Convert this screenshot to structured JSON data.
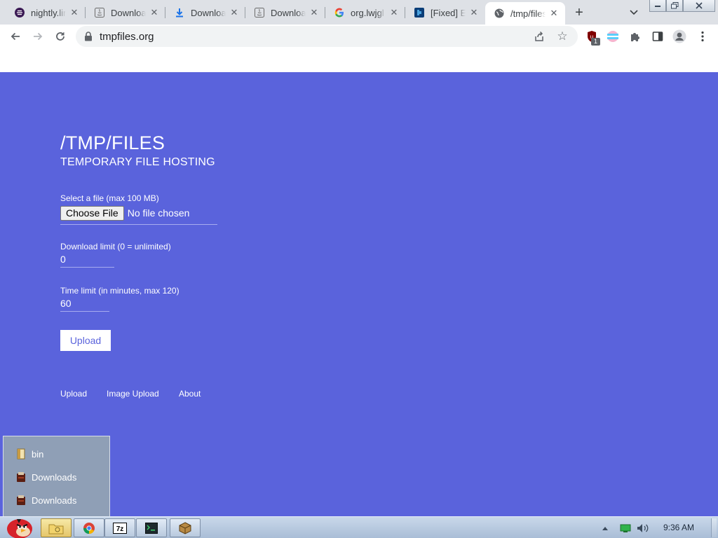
{
  "browser": {
    "tabs": [
      {
        "title": "nightly.lin",
        "icon": "eclipse-icon"
      },
      {
        "title": "Download",
        "icon": "java-icon"
      },
      {
        "title": "Download",
        "icon": "download-icon"
      },
      {
        "title": "Download",
        "icon": "java-icon"
      },
      {
        "title": "org.lwjgl",
        "icon": "google-icon"
      },
      {
        "title": "[Fixed] E",
        "icon": "site-icon"
      },
      {
        "title": "/tmp/files",
        "icon": "globe-icon",
        "active": true
      }
    ],
    "url": "tmpfiles.org",
    "extension_badge": "1"
  },
  "page": {
    "title": "/TMP/FILES",
    "subtitle": "TEMPORARY FILE HOSTING",
    "file_label": "Select a file (max 100 MB)",
    "choose_file_label": "Choose File",
    "no_file_text": "No file chosen",
    "download_limit_label": "Download limit (0 = unlimited)",
    "download_limit_value": "0",
    "time_limit_label": "Time limit (in minutes, max 120)",
    "time_limit_value": "60",
    "upload_button": "Upload",
    "footer_links": [
      "Upload",
      "Image Upload",
      "About"
    ],
    "colors": {
      "background": "#5a63dc",
      "text": "#ffffff"
    }
  },
  "folder_menu": {
    "items": [
      {
        "label": "bin"
      },
      {
        "label": "Downloads"
      },
      {
        "label": "Downloads"
      }
    ]
  },
  "taskbar": {
    "clock": "9:36 AM",
    "apps": [
      "angry-birds-start-icon",
      "folder-icon",
      "chrome-icon",
      "7zip-icon",
      "terminal-icon",
      "package-icon"
    ]
  }
}
